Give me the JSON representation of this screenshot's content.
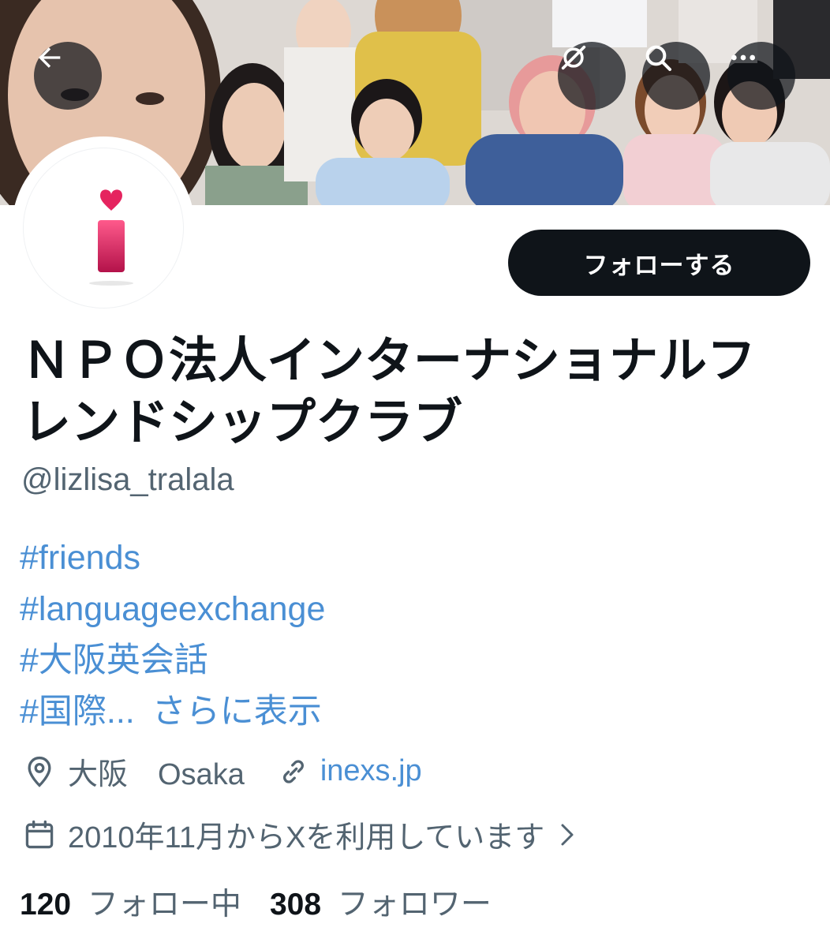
{
  "profile": {
    "display_name": "ＮＰＯ法人インターナショナルフレンドシップクラブ",
    "handle": "@lizlisa_tralala",
    "follow_label": "フォローする",
    "bio_tags": [
      "#friends",
      "#languageexchange",
      "#大阪英会話",
      "#国際..."
    ],
    "bio_more": "さらに表示",
    "location": "大阪　Osaka",
    "website": "inexs.jp",
    "joined": "2010年11月からXを利用しています",
    "following_count": "120",
    "following_label": "フォロー中",
    "followers_count": "308",
    "followers_label": "フォロワー"
  },
  "icons": {
    "back": "arrow-left-icon",
    "translate": "grok-icon",
    "search": "search-icon",
    "more": "more-horizontal-icon",
    "location": "location-pin-icon",
    "link": "link-icon",
    "calendar": "calendar-icon",
    "chevron": "chevron-right-icon"
  },
  "colors": {
    "link": "#4a8fd4",
    "muted": "#536471",
    "button_bg": "#0f1419",
    "avatar_heart": "#d81b60"
  }
}
